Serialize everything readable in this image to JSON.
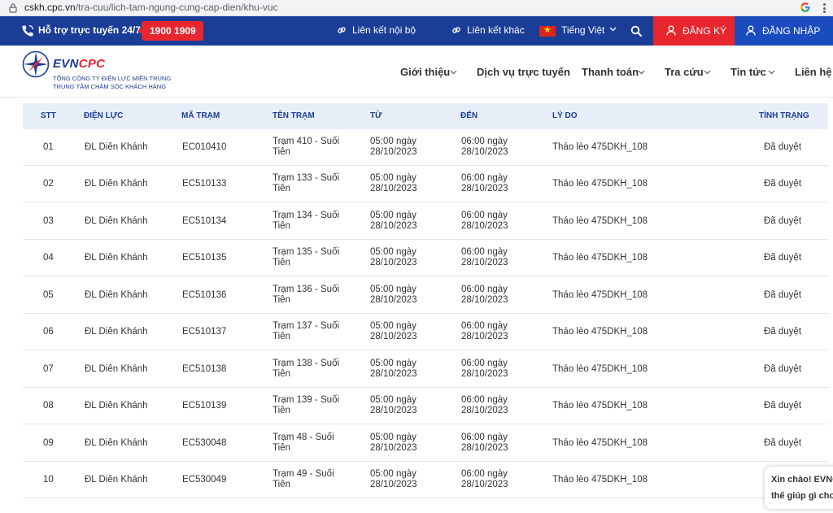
{
  "browser": {
    "url_host": "cskh.cpc.vn",
    "url_path": "/tra-cuu/lich-tam-ngung-cung-cap-dien/khu-vuc"
  },
  "topbar": {
    "hotline_label": "Hỗ trợ trực tuyến 24/7:",
    "hotline_number": "1900 1909",
    "internal_link": "Liên kết nội bộ",
    "other_link": "Liên kết khác",
    "language": "Tiếng Việt",
    "register": "ĐĂNG KÝ",
    "login": "ĐĂNG NHẬP"
  },
  "brand": {
    "logo_main": "EVN",
    "logo_accent": "CPC",
    "sub1": "TỔNG CÔNG TY ĐIỆN LỰC MIỀN TRUNG",
    "sub2": "TRUNG TÂM CHĂM SÓC KHÁCH HÀNG"
  },
  "nav": {
    "intro": "Giới thiệu",
    "online_services": "Dịch vụ trực tuyến",
    "payment": "Thanh toán",
    "lookup": "Tra cứu",
    "news": "Tin tức",
    "contact": "Liên hệ"
  },
  "table": {
    "headers": [
      "STT",
      "ĐIỆN LỰC",
      "MÃ TRẠM",
      "TÊN TRẠM",
      "TỪ",
      "ĐẾN",
      "LÝ DO",
      "TÌNH TRẠNG"
    ],
    "rows": [
      {
        "stt": "01",
        "dl": "ĐL Diên Khánh",
        "ma": "EC010410",
        "ten": "Trạm 410 - Suối Tiên",
        "tu": "05:00 ngày 28/10/2023",
        "den": "06:00 ngày 28/10/2023",
        "lydo": "Tháo lèo 475DKH_108",
        "tt": "Đã duyệt"
      },
      {
        "stt": "02",
        "dl": "ĐL Diên Khánh",
        "ma": "EC510133",
        "ten": "Trạm 133 - Suối Tiên",
        "tu": "05:00 ngày 28/10/2023",
        "den": "06:00 ngày 28/10/2023",
        "lydo": "Tháo lèo 475DKH_108",
        "tt": "Đã duyệt"
      },
      {
        "stt": "03",
        "dl": "ĐL Diên Khánh",
        "ma": "EC510134",
        "ten": "Trạm 134 - Suối Tiên",
        "tu": "05:00 ngày 28/10/2023",
        "den": "06:00 ngày 28/10/2023",
        "lydo": "Tháo lèo 475DKH_108",
        "tt": "Đã duyệt"
      },
      {
        "stt": "04",
        "dl": "ĐL Diên Khánh",
        "ma": "EC510135",
        "ten": "Trạm 135 - Suối Tiên",
        "tu": "05:00 ngày 28/10/2023",
        "den": "06:00 ngày 28/10/2023",
        "lydo": "Tháo lèo 475DKH_108",
        "tt": "Đã duyệt"
      },
      {
        "stt": "05",
        "dl": "ĐL Diên Khánh",
        "ma": "EC510136",
        "ten": "Trạm 136 - Suối Tiên",
        "tu": "05:00 ngày 28/10/2023",
        "den": "06:00 ngày 28/10/2023",
        "lydo": "Tháo lèo 475DKH_108",
        "tt": "Đã duyệt"
      },
      {
        "stt": "06",
        "dl": "ĐL Diên Khánh",
        "ma": "EC510137",
        "ten": "Trạm 137 - Suối Tiên",
        "tu": "05:00 ngày 28/10/2023",
        "den": "06:00 ngày 28/10/2023",
        "lydo": "Tháo lèo 475DKH_108",
        "tt": "Đã duyệt"
      },
      {
        "stt": "07",
        "dl": "ĐL Diên Khánh",
        "ma": "EC510138",
        "ten": "Trạm 138 - Suối Tiên",
        "tu": "05:00 ngày 28/10/2023",
        "den": "06:00 ngày 28/10/2023",
        "lydo": "Tháo lèo 475DKH_108",
        "tt": "Đã duyệt"
      },
      {
        "stt": "08",
        "dl": "ĐL Diên Khánh",
        "ma": "EC510139",
        "ten": "Trạm 139 - Suối Tiên",
        "tu": "05:00 ngày 28/10/2023",
        "den": "06:00 ngày 28/10/2023",
        "lydo": "Tháo lèo 475DKH_108",
        "tt": "Đã duyệt"
      },
      {
        "stt": "09",
        "dl": "ĐL Diên Khánh",
        "ma": "EC530048",
        "ten": "Trạm 48 - Suối Tiên",
        "tu": "05:00 ngày 28/10/2023",
        "den": "06:00 ngày 28/10/2023",
        "lydo": "Tháo lèo 475DKH_108",
        "tt": "Đã duyệt"
      },
      {
        "stt": "10",
        "dl": "ĐL Diên Khánh",
        "ma": "EC530049",
        "ten": "Trạm 49 - Suối Tiên",
        "tu": "05:00 ngày 28/10/2023",
        "den": "06:00 ngày 28/10/2023",
        "lydo": "Tháo lèo 475DKH_108",
        "tt": ""
      }
    ]
  },
  "chat": {
    "line1": "Xin chào! EVNC",
    "line2": "thế giúp gì cho"
  },
  "colors": {
    "primary": "#1a3d98",
    "accent": "#e8262d",
    "login_bg": "#1a4bbf",
    "header_row": "#e8eef8"
  }
}
